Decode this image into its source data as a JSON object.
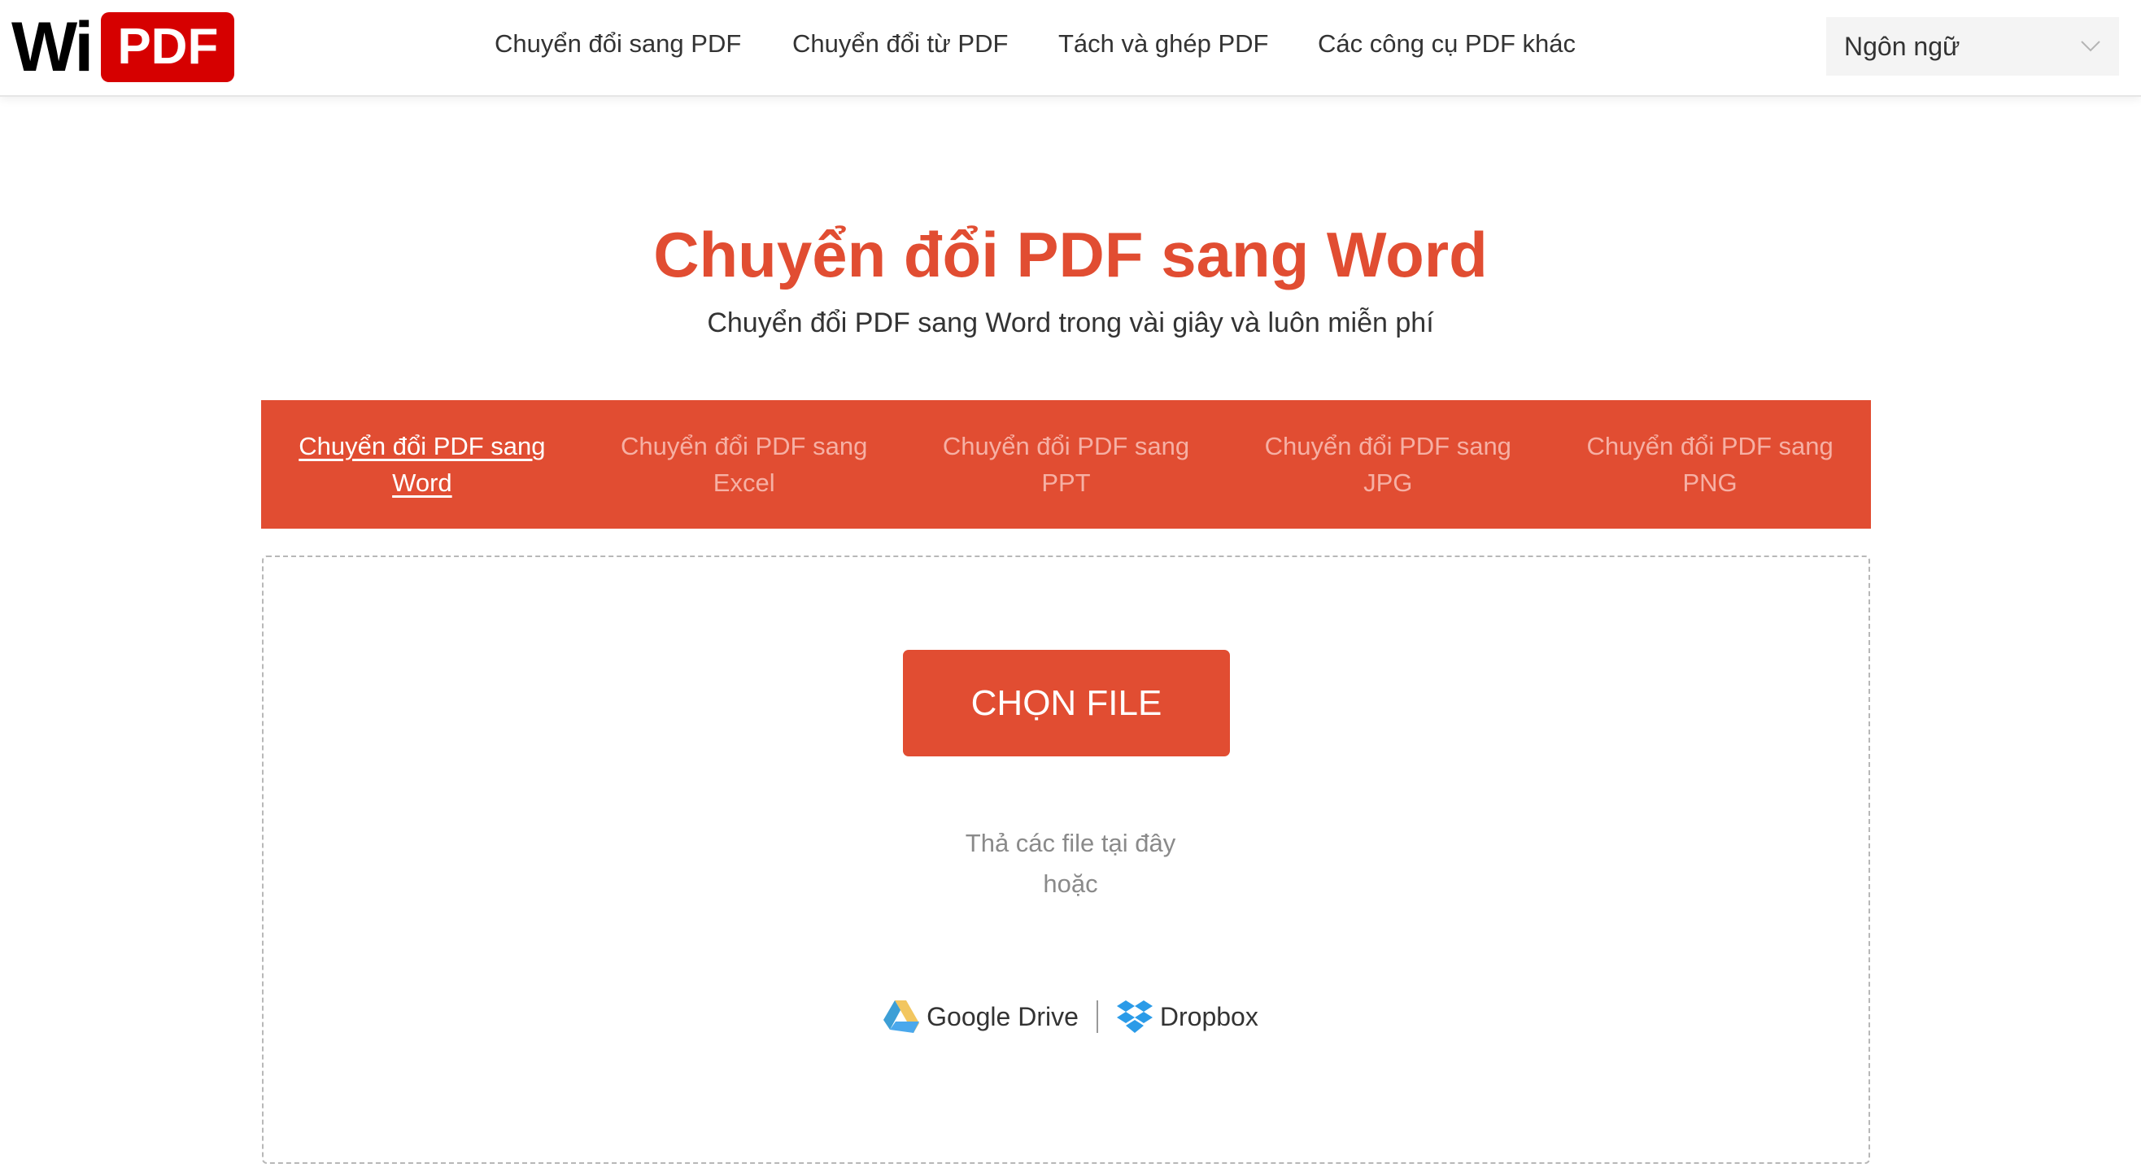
{
  "header": {
    "logo": {
      "wi": "Wi",
      "pdf": "PDF"
    },
    "nav": [
      {
        "label": "Chuyển đổi sang PDF"
      },
      {
        "label": "Chuyển đổi từ PDF"
      },
      {
        "label": "Tách và ghép PDF"
      },
      {
        "label": "Các công cụ PDF khác"
      }
    ],
    "language": {
      "label": "Ngôn ngữ",
      "icon": "chevron-down-icon"
    }
  },
  "main": {
    "title": "Chuyển đổi PDF sang Word",
    "subtitle": "Chuyển đổi PDF sang Word trong vài giây và luôn miễn phí",
    "tabs": [
      {
        "label": "Chuyển đổi PDF sang Word",
        "active": true
      },
      {
        "label": "Chuyển đổi PDF sang Excel",
        "active": false
      },
      {
        "label": "Chuyển đổi PDF sang PPT",
        "active": false
      },
      {
        "label": "Chuyển đổi PDF sang JPG",
        "active": false
      },
      {
        "label": "Chuyển đổi PDF sang PNG",
        "active": false
      }
    ],
    "dropzone": {
      "button_label": "CHỌN FILE",
      "drop_text": "Thả các file tại đây",
      "or_text": "hoặc",
      "sources": [
        {
          "label": "Google Drive",
          "icon": "google-drive-icon"
        },
        {
          "label": "Dropbox",
          "icon": "dropbox-icon"
        }
      ]
    }
  },
  "colors": {
    "accent": "#e14d32",
    "logo_red": "#d60000",
    "inactive_tab_text": "#f6b0a4",
    "muted_text": "#8a8a8a",
    "dropbox_blue": "#2b9be8"
  }
}
